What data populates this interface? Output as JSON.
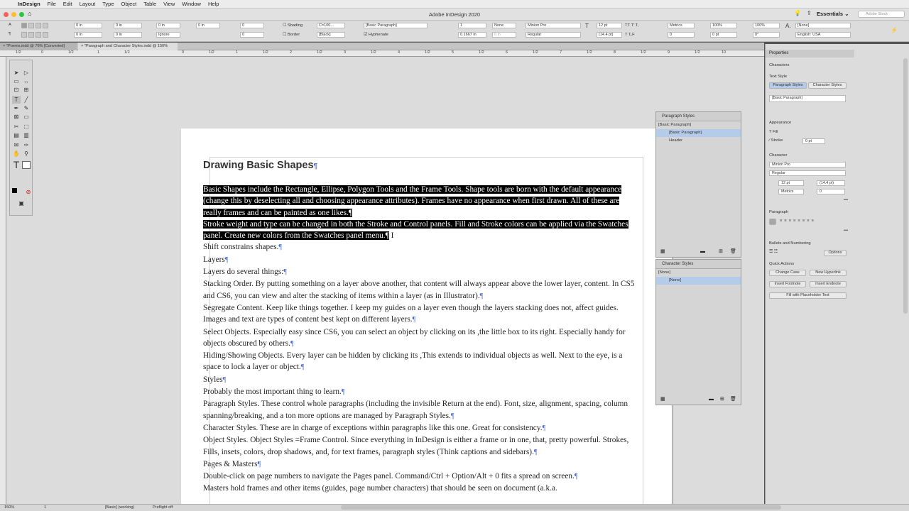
{
  "menubar": {
    "app_name": "InDesign",
    "items": [
      "File",
      "Edit",
      "Layout",
      "Type",
      "Object",
      "Table",
      "View",
      "Window",
      "Help"
    ]
  },
  "app_title": "Adobe InDesign 2020",
  "workspace": "Essentials",
  "stock_search": "Adobe Stock",
  "control": {
    "x1": "0 in",
    "x2": "0 in",
    "y1": "0 in",
    "y2": "0 in",
    "ignore": "Ignore",
    "zero1": "0",
    "zero2": "0",
    "shading": "Shading",
    "border": "Border",
    "swatch_cmyk": "C=100...",
    "swatch_black": "[Black]",
    "para_style": "[Basic Paragraph]",
    "hyphenate": "Hyphenate",
    "cols": "1",
    "col_w": "0.1667 in",
    "none1": "None",
    "gut": "0 in",
    "font": "Minion Pro",
    "weight": "Regular",
    "size": "12 pt",
    "leading": "(14.4 pt)",
    "kern": "Metrics",
    "track": "0",
    "scale_v": "100%",
    "scale_h": "100%",
    "baseline": "0 pt",
    "skew": "0°",
    "char_style": "[None]",
    "lang": "English: USA"
  },
  "tabs": [
    {
      "label": "*Poems.indd @ 76% [Converted]"
    },
    {
      "label": "*Paragraph and Character Styles.indd @ 150%"
    }
  ],
  "ruler_labels": [
    "1/2",
    "0",
    "1/2",
    "1",
    "1/2",
    "2",
    "1/2",
    "3",
    "1/2",
    "4",
    "1/2",
    "5",
    "1/2",
    "6",
    "1/2",
    "7",
    "1/2",
    "8",
    "1/2",
    "9",
    "1/2",
    "10",
    "1/2",
    "11",
    "1/2",
    "12"
  ],
  "document": {
    "heading": "Drawing Basic Shapes",
    "selected_paragraphs": [
      "Basic Shapes include the Rectangle, Ellipse, Polygon Tools and the Frame Tools. Shape tools are born with the default appearance (change this by deselecting all and choosing appearance attributes). Frames have no appearance when first drawn. All of these are really frames and can be painted as one likes.",
      "Stroke weight and type can be changed in both the Stroke and Control panels. Fill and Stroke colors can be applied via the Swatches panel. Create new colors from the Swatches panel menu."
    ],
    "paragraphs": [
      "Shift constrains shapes.",
      "Layers",
      "Layers do several things:",
      "Stacking Order. By putting something on a layer above another, that content will always appear above the lower layer, content. In CS5 and CS6, you can view and alter the stacking of items within a layer (as in Illustrator).",
      "Segregate Content. Keep like things together. I keep my guides on a layer even though the layers stacking does not, affect guides. Images and text are types of content best kept on different layers.",
      "Select Objects. Especially easy since CS6, you can select an object by clicking on its ,the little box to its right. Especially handy for objects obscured by others.",
      "Hiding/Showing Objects. Every layer can be hidden by clicking its ,This extends to individual objects as well. Next to the eye, is a space to lock a layer or object.",
      "Styles",
      "Probably the most important thing to learn.",
      "Paragraph Styles. These control whole paragraphs (including the invisible Return at the end). Font, size, alignment, spacing, column spanning/breaking, and a ton more options are managed by Paragraph Styles.",
      "Character Styles. These are in charge of exceptions within paragraphs like this one. Great for consistency.",
      "Object Styles. Object Styles =Frame Control. Since everything in InDesign is either a frame or in one, that, pretty powerful. Strokes, Fills, insets, colors, drop shadows, and, for text frames, paragraph styles (Think captions and sidebars).",
      "Pages & Masters",
      "Double-click on page numbers to navigate the Pages panel. Command/Ctrl + Option/Alt + 0 fits a spread on screen.",
      "Masters hold frames and other items (guides, page number characters) that should be seen on document (a.k.a."
    ]
  },
  "paragraph_styles_panel": {
    "title": "Paragraph Styles",
    "current": "[Basic Paragraph]",
    "items": [
      "[Basic Paragraph]",
      "Header"
    ]
  },
  "character_styles_panel": {
    "title": "Character Styles",
    "current": "[None]",
    "items": [
      "[None]"
    ]
  },
  "properties": {
    "title": "Properties",
    "subtitle": "Characters",
    "text_style": "Text Style",
    "tab_para": "Paragraph Styles",
    "tab_char": "Character Styles",
    "style_value": "[Basic Paragraph]",
    "appearance": "Appearance",
    "fill": "Fill",
    "stroke": "Stroke",
    "stroke_value": "0 pt",
    "character": "Character",
    "font": "Minion Pro",
    "weight": "Regular",
    "size": "12 pt",
    "leading": "(14.4 pt)",
    "kern": "Metrics",
    "track": "0",
    "paragraph": "Paragraph",
    "bullets": "Bullets and Numbering",
    "options": "Options",
    "quick_actions": "Quick Actions",
    "change_case": "Change Case",
    "new_hyperlink": "New Hyperlink",
    "insert_footnote": "Insert Footnote",
    "insert_endnote": "Insert Endnote",
    "fill_placeholder": "Fill with Placeholder Text"
  },
  "status": {
    "zoom": "150%",
    "page": "1",
    "style": "[Basic] (working)",
    "preflight": "Preflight off"
  }
}
